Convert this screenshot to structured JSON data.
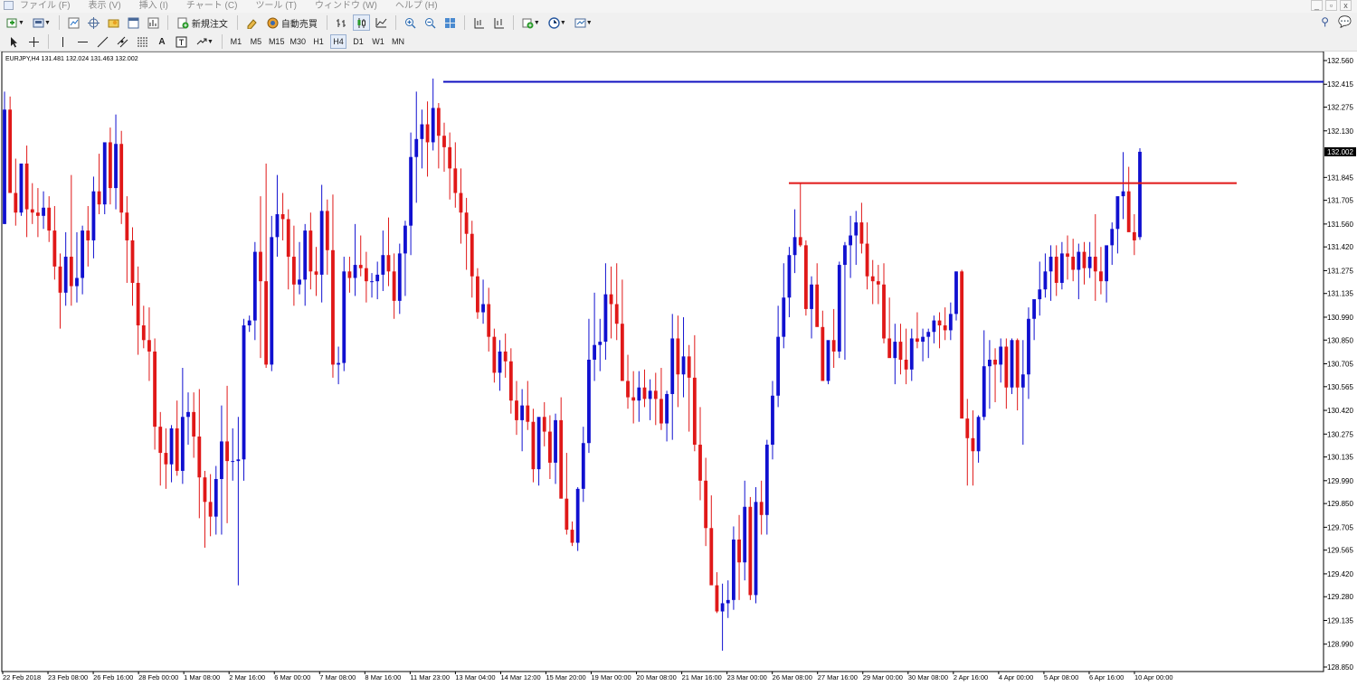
{
  "menubar": {
    "items": [
      "ファイル (F)",
      "表示 (V)",
      "挿入 (I)",
      "チャート (C)",
      "ツール (T)",
      "ウィンドウ (W)",
      "ヘルプ (H)"
    ],
    "window_buttons": [
      "_",
      "▫",
      "x"
    ]
  },
  "toolbar": {
    "new_order_label": "新規注文",
    "autotrade_label": "自動売買",
    "timeframes": [
      "M1",
      "M5",
      "M15",
      "M30",
      "H1",
      "H4",
      "D1",
      "W1",
      "MN"
    ],
    "active_timeframe": "H4"
  },
  "chart": {
    "title_line": "EURJPY,H4  131.481 132.024 131.463 132.002",
    "current_price_label": "132.002",
    "colors": {
      "bull": "#1010d0",
      "bear": "#e01818",
      "blue_line": "#1010c0",
      "red_line": "#e01818"
    }
  },
  "chart_data": {
    "type": "candlestick",
    "symbol": "EURJPY",
    "timeframe": "H4",
    "ohlc_header": {
      "open": 131.481,
      "high": 132.024,
      "low": 131.463,
      "close": 132.002
    },
    "price_ticks": [
      "132.560",
      "132.415",
      "132.275",
      "132.130",
      "131.845",
      "131.705",
      "131.560",
      "131.420",
      "131.275",
      "131.135",
      "130.990",
      "130.850",
      "130.705",
      "130.565",
      "130.420",
      "130.275",
      "130.135",
      "129.990",
      "129.850",
      "129.705",
      "129.565",
      "129.420",
      "129.280",
      "129.135",
      "128.990",
      "128.850"
    ],
    "current_price": "132.002",
    "ylim": [
      128.85,
      132.56
    ],
    "x_labels": [
      "22 Feb 2018",
      "23 Feb 08:00",
      "26 Feb 16:00",
      "28 Feb 00:00",
      "1 Mar 08:00",
      "2 Mar 16:00",
      "6 Mar 00:00",
      "7 Mar 08:00",
      "8 Mar 16:00",
      "11 Mar 23:00",
      "13 Mar 04:00",
      "14 Mar 12:00",
      "15 Mar 20:00",
      "19 Mar 00:00",
      "20 Mar 08:00",
      "21 Mar 16:00",
      "23 Mar 00:00",
      "26 Mar 08:00",
      "27 Mar 16:00",
      "29 Mar 00:00",
      "30 Mar 08:00",
      "2 Apr 16:00",
      "4 Apr 00:00",
      "5 Apr 08:00",
      "6 Apr 16:00",
      "10 Apr 00:00"
    ],
    "horizontal_lines": [
      {
        "price": 132.43,
        "color": "blue",
        "from_label": "13 Mar 04:00"
      },
      {
        "price": 131.81,
        "color": "red",
        "from_label": "26 Mar 08:00"
      }
    ],
    "candles": [
      [
        131.56,
        132.37,
        131.56,
        132.26
      ],
      [
        132.26,
        132.34,
        131.9,
        131.75
      ],
      [
        131.75,
        131.96,
        131.55,
        131.63
      ],
      [
        131.63,
        131.81,
        131.61,
        131.93
      ],
      [
        131.93,
        132.04,
        131.48,
        131.65
      ],
      [
        131.65,
        131.81,
        131.56,
        131.63
      ],
      [
        131.63,
        131.78,
        131.48,
        131.61
      ],
      [
        131.61,
        131.76,
        131.53,
        131.66
      ],
      [
        131.66,
        131.73,
        131.45,
        131.52
      ],
      [
        131.52,
        131.67,
        131.22,
        131.3
      ],
      [
        131.3,
        131.38,
        130.92,
        131.14
      ],
      [
        131.14,
        131.51,
        131.06,
        131.36
      ],
      [
        131.36,
        131.86,
        131.06,
        131.18
      ],
      [
        131.18,
        131.51,
        131.08,
        131.23
      ],
      [
        131.23,
        131.55,
        131.13,
        131.52
      ],
      [
        131.52,
        131.67,
        131.3,
        131.46
      ],
      [
        131.46,
        131.85,
        131.35,
        131.76
      ],
      [
        131.76,
        131.99,
        131.62,
        131.68
      ],
      [
        131.68,
        132.03,
        131.62,
        132.06
      ],
      [
        132.06,
        132.15,
        131.68,
        131.78
      ],
      [
        131.78,
        132.23,
        131.65,
        132.05
      ],
      [
        132.05,
        132.13,
        131.56,
        131.63
      ],
      [
        131.63,
        131.73,
        131.2,
        131.46
      ],
      [
        131.46,
        131.54,
        131.06,
        131.2
      ],
      [
        131.2,
        131.3,
        130.76,
        130.94
      ],
      [
        130.94,
        131.06,
        130.8,
        130.85
      ],
      [
        130.85,
        131.05,
        130.6,
        130.78
      ],
      [
        130.78,
        130.86,
        130.18,
        130.32
      ],
      [
        130.32,
        130.41,
        129.96,
        130.16
      ],
      [
        130.16,
        130.31,
        129.94,
        130.09
      ],
      [
        130.09,
        130.33,
        129.98,
        130.31
      ],
      [
        130.31,
        130.48,
        130.02,
        130.05
      ],
      [
        130.05,
        130.68,
        129.97,
        130.38
      ],
      [
        130.38,
        130.53,
        130.21,
        130.41
      ],
      [
        130.41,
        130.53,
        130.13,
        130.26
      ],
      [
        130.26,
        130.55,
        129.76,
        130.01
      ],
      [
        130.01,
        130.05,
        129.58,
        129.86
      ],
      [
        129.86,
        130.03,
        129.65,
        129.77
      ],
      [
        129.77,
        130.08,
        129.66,
        130.0
      ],
      [
        130.0,
        130.45,
        129.66,
        130.23
      ],
      [
        130.23,
        130.57,
        129.73,
        130.11
      ],
      [
        130.11,
        130.31,
        129.99,
        130.11
      ],
      [
        130.11,
        130.38,
        129.35,
        130.12
      ],
      [
        130.12,
        130.98,
        129.99,
        130.94
      ],
      [
        130.94,
        131.0,
        130.9,
        130.97
      ],
      [
        130.97,
        131.45,
        130.85,
        131.39
      ],
      [
        131.39,
        131.73,
        130.74,
        131.21
      ],
      [
        131.21,
        131.93,
        130.68,
        130.7
      ],
      [
        130.7,
        131.61,
        130.66,
        131.48
      ],
      [
        131.48,
        131.86,
        131.36,
        131.62
      ],
      [
        131.62,
        131.75,
        131.46,
        131.59
      ],
      [
        131.59,
        131.65,
        131.16,
        131.36
      ],
      [
        131.36,
        131.55,
        131.06,
        131.19
      ],
      [
        131.19,
        131.45,
        131.13,
        131.22
      ],
      [
        131.22,
        131.56,
        131.06,
        131.52
      ],
      [
        131.52,
        131.63,
        131.16,
        131.27
      ],
      [
        131.27,
        131.42,
        131.12,
        131.25
      ],
      [
        131.25,
        131.8,
        131.08,
        131.64
      ],
      [
        131.64,
        131.71,
        131.25,
        131.4
      ],
      [
        131.4,
        131.74,
        130.62,
        130.7
      ],
      [
        130.7,
        130.81,
        130.58,
        130.71
      ],
      [
        130.71,
        131.36,
        130.66,
        131.27
      ],
      [
        131.27,
        131.36,
        131.14,
        131.23
      ],
      [
        131.23,
        131.56,
        131.12,
        131.31
      ],
      [
        131.31,
        131.49,
        131.24,
        131.29
      ],
      [
        131.29,
        131.39,
        131.08,
        131.21
      ],
      [
        131.21,
        131.26,
        131.11,
        131.21
      ],
      [
        131.21,
        131.33,
        131.1,
        131.25
      ],
      [
        131.25,
        131.52,
        131.15,
        131.37
      ],
      [
        131.37,
        131.6,
        131.18,
        131.27
      ],
      [
        131.27,
        131.38,
        130.98,
        131.09
      ],
      [
        131.09,
        131.44,
        131.01,
        131.38
      ],
      [
        131.38,
        131.58,
        131.12,
        131.55
      ],
      [
        131.55,
        132.12,
        131.37,
        131.97
      ],
      [
        131.97,
        132.37,
        131.69,
        132.08
      ],
      [
        132.08,
        132.26,
        131.9,
        132.17
      ],
      [
        132.17,
        132.31,
        131.85,
        132.06
      ],
      [
        132.06,
        132.45,
        132.01,
        132.27
      ],
      [
        132.27,
        132.3,
        131.9,
        132.1
      ],
      [
        132.1,
        132.18,
        131.88,
        132.03
      ],
      [
        132.03,
        132.12,
        131.71,
        131.9
      ],
      [
        131.9,
        132.06,
        131.66,
        131.75
      ],
      [
        131.75,
        131.9,
        131.44,
        131.63
      ],
      [
        131.63,
        131.72,
        131.28,
        131.5
      ],
      [
        131.5,
        131.58,
        131.11,
        131.24
      ],
      [
        131.24,
        131.29,
        130.98,
        131.02
      ],
      [
        131.02,
        131.22,
        130.95,
        131.07
      ],
      [
        131.07,
        131.17,
        130.78,
        130.87
      ],
      [
        130.87,
        130.92,
        130.59,
        130.65
      ],
      [
        130.65,
        130.85,
        130.54,
        130.78
      ],
      [
        130.78,
        130.89,
        130.62,
        130.72
      ],
      [
        130.72,
        130.8,
        130.4,
        130.48
      ],
      [
        130.48,
        130.6,
        130.27,
        130.36
      ],
      [
        130.36,
        130.55,
        130.17,
        130.45
      ],
      [
        130.45,
        130.6,
        130.3,
        130.35
      ],
      [
        130.35,
        130.43,
        129.98,
        130.06
      ],
      [
        130.06,
        130.35,
        129.96,
        130.38
      ],
      [
        130.38,
        130.47,
        130.2,
        130.29
      ],
      [
        130.29,
        130.39,
        130.0,
        130.1
      ],
      [
        130.1,
        130.4,
        129.97,
        130.36
      ],
      [
        130.36,
        130.5,
        129.93,
        129.88
      ],
      [
        129.88,
        130.16,
        129.66,
        129.69
      ],
      [
        129.69,
        129.74,
        129.59,
        129.61
      ],
      [
        129.61,
        129.95,
        129.56,
        129.94
      ],
      [
        129.94,
        130.32,
        129.86,
        130.22
      ],
      [
        130.22,
        130.98,
        130.16,
        130.73
      ],
      [
        130.73,
        131.14,
        130.6,
        130.82
      ],
      [
        130.82,
        130.98,
        130.66,
        130.84
      ],
      [
        130.84,
        131.32,
        130.73,
        131.13
      ],
      [
        131.13,
        131.3,
        130.86,
        131.07
      ],
      [
        131.07,
        131.32,
        130.85,
        130.95
      ],
      [
        130.95,
        131.22,
        130.66,
        130.6
      ],
      [
        130.6,
        130.76,
        130.43,
        130.5
      ],
      [
        130.5,
        130.66,
        130.34,
        130.48
      ],
      [
        130.48,
        130.66,
        130.35,
        130.56
      ],
      [
        130.56,
        130.67,
        130.44,
        130.49
      ],
      [
        130.49,
        130.61,
        130.36,
        130.54
      ],
      [
        130.54,
        130.65,
        130.33,
        130.49
      ],
      [
        130.49,
        130.68,
        130.3,
        130.34
      ],
      [
        130.34,
        130.54,
        130.23,
        130.52
      ],
      [
        130.52,
        131.01,
        130.24,
        130.86
      ],
      [
        130.86,
        131.0,
        130.44,
        130.64
      ],
      [
        130.64,
        130.99,
        130.5,
        130.75
      ],
      [
        130.75,
        130.82,
        130.29,
        130.62
      ],
      [
        130.62,
        130.88,
        130.17,
        130.21
      ],
      [
        130.21,
        130.44,
        129.87,
        129.99
      ],
      [
        129.99,
        130.13,
        129.59,
        129.7
      ],
      [
        129.7,
        129.9,
        129.45,
        129.35
      ],
      [
        129.35,
        129.43,
        129.18,
        129.19
      ],
      [
        129.19,
        129.36,
        128.95,
        129.24
      ],
      [
        129.24,
        129.38,
        129.15,
        129.26
      ],
      [
        129.26,
        129.71,
        129.2,
        129.63
      ],
      [
        129.63,
        129.78,
        129.26,
        129.49
      ],
      [
        129.49,
        129.99,
        129.38,
        129.83
      ],
      [
        129.83,
        129.89,
        129.26,
        129.29
      ],
      [
        129.29,
        129.95,
        129.24,
        129.86
      ],
      [
        129.86,
        129.99,
        129.66,
        129.78
      ],
      [
        129.78,
        130.24,
        129.66,
        130.21
      ],
      [
        130.21,
        130.6,
        130.12,
        130.51
      ],
      [
        130.51,
        131.06,
        130.44,
        130.87
      ],
      [
        130.87,
        131.32,
        130.8,
        131.11
      ],
      [
        131.11,
        131.42,
        130.99,
        131.37
      ],
      [
        131.37,
        131.65,
        131.26,
        131.48
      ],
      [
        131.48,
        131.81,
        131.42,
        131.43
      ],
      [
        131.43,
        131.46,
        131.0,
        131.04
      ],
      [
        131.04,
        131.24,
        130.86,
        131.19
      ],
      [
        131.19,
        131.32,
        130.95,
        130.93
      ],
      [
        130.93,
        131.03,
        130.6,
        130.6
      ],
      [
        130.6,
        130.81,
        130.58,
        130.85
      ],
      [
        130.85,
        131.04,
        130.68,
        130.78
      ],
      [
        130.78,
        131.33,
        130.74,
        131.31
      ],
      [
        131.31,
        131.45,
        130.73,
        131.43
      ],
      [
        131.43,
        131.61,
        131.23,
        131.49
      ],
      [
        131.49,
        131.64,
        131.31,
        131.57
      ],
      [
        131.57,
        131.69,
        131.38,
        131.44
      ],
      [
        131.44,
        131.57,
        131.16,
        131.24
      ],
      [
        131.24,
        131.34,
        131.07,
        131.21
      ],
      [
        131.21,
        131.31,
        131.07,
        131.19
      ],
      [
        131.19,
        131.32,
        130.83,
        130.86
      ],
      [
        130.86,
        131.11,
        130.76,
        130.74
      ],
      [
        130.74,
        130.95,
        130.58,
        130.84
      ],
      [
        130.84,
        130.95,
        130.64,
        130.73
      ],
      [
        130.73,
        130.92,
        130.58,
        130.67
      ],
      [
        130.67,
        130.92,
        130.6,
        130.86
      ],
      [
        130.86,
        131.02,
        130.8,
        130.84
      ],
      [
        130.84,
        130.92,
        130.72,
        130.87
      ],
      [
        130.87,
        130.92,
        130.74,
        130.9
      ],
      [
        130.9,
        131.0,
        130.83,
        130.97
      ],
      [
        130.97,
        131.02,
        130.8,
        130.94
      ],
      [
        130.94,
        131.05,
        130.85,
        130.91
      ],
      [
        130.91,
        131.08,
        130.85,
        131.01
      ],
      [
        131.01,
        131.27,
        130.97,
        131.27
      ],
      [
        131.27,
        131.28,
        130.39,
        130.37
      ],
      [
        130.37,
        130.49,
        129.96,
        130.25
      ],
      [
        130.25,
        130.42,
        129.96,
        130.17
      ],
      [
        130.17,
        130.39,
        130.1,
        130.38
      ],
      [
        130.38,
        130.91,
        130.36,
        130.69
      ],
      [
        130.69,
        130.85,
        130.43,
        130.73
      ],
      [
        130.73,
        130.8,
        130.47,
        130.7
      ],
      [
        130.7,
        130.86,
        130.59,
        130.81
      ],
      [
        130.81,
        130.86,
        130.43,
        130.56
      ],
      [
        130.56,
        130.86,
        130.52,
        130.85
      ],
      [
        130.85,
        130.86,
        130.42,
        130.56
      ],
      [
        130.56,
        130.85,
        130.21,
        130.64
      ],
      [
        130.64,
        131.05,
        130.49,
        130.98
      ],
      [
        130.98,
        131.09,
        130.85,
        131.1
      ],
      [
        131.1,
        131.33,
        131.0,
        131.16
      ],
      [
        131.16,
        131.38,
        131.11,
        131.27
      ],
      [
        131.27,
        131.43,
        131.09,
        131.36
      ],
      [
        131.36,
        131.43,
        131.12,
        131.2
      ],
      [
        131.2,
        131.45,
        131.16,
        131.38
      ],
      [
        131.38,
        131.49,
        131.22,
        131.36
      ],
      [
        131.36,
        131.47,
        131.21,
        131.28
      ],
      [
        131.28,
        131.44,
        131.1,
        131.39
      ],
      [
        131.39,
        131.45,
        131.19,
        131.29
      ],
      [
        131.29,
        131.45,
        131.23,
        131.36
      ],
      [
        131.36,
        131.62,
        131.09,
        131.27
      ],
      [
        131.27,
        131.42,
        131.13,
        131.21
      ],
      [
        131.21,
        131.38,
        131.08,
        131.43
      ],
      [
        131.43,
        131.57,
        131.31,
        131.53
      ],
      [
        131.53,
        131.71,
        131.38,
        131.73
      ],
      [
        131.73,
        132.0,
        131.59,
        131.76
      ],
      [
        131.76,
        131.91,
        131.55,
        131.51
      ],
      [
        131.51,
        131.62,
        131.37,
        131.46
      ],
      [
        131.48,
        132.024,
        131.463,
        132.002
      ]
    ]
  }
}
